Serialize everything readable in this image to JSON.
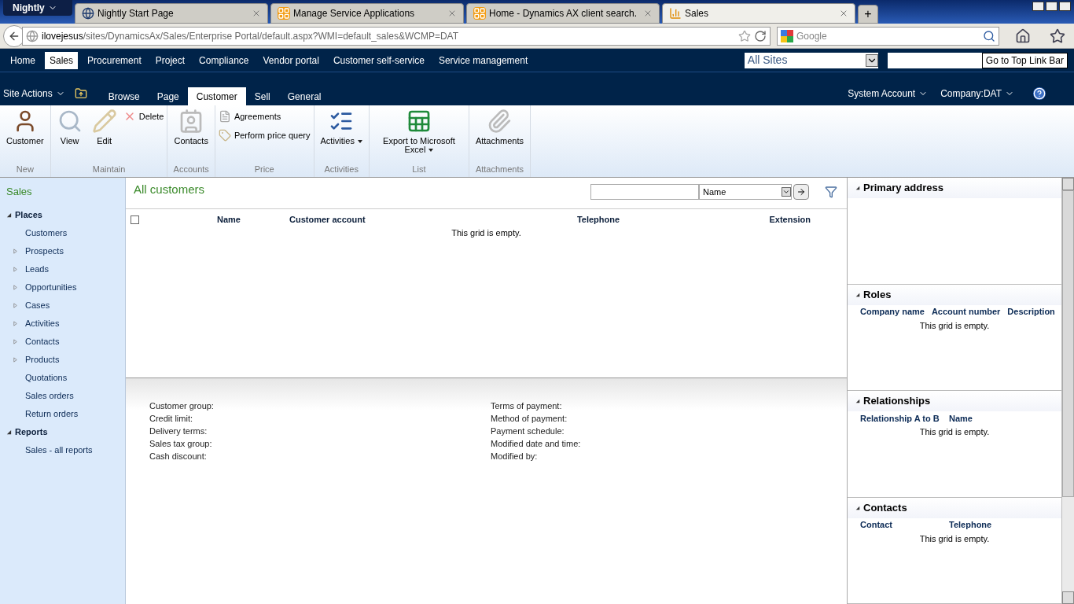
{
  "browser": {
    "menu_button": "Nightly",
    "tabs": [
      {
        "title": "Nightly Start Page",
        "selected": false
      },
      {
        "title": "Manage Service Applications",
        "selected": false
      },
      {
        "title": "Home - Dynamics AX client search.",
        "selected": false
      },
      {
        "title": "Sales",
        "selected": true
      }
    ],
    "new_tab": "+",
    "address": {
      "host": "ilovejesus",
      "path": "/sites/DynamicsAx/Sales/Enterprise Portal/default.aspx?WMI=default_sales&WCMP=DAT"
    },
    "search": {
      "placeholder": "Google"
    }
  },
  "top_links": [
    {
      "label": "Home",
      "selected": false
    },
    {
      "label": "Sales",
      "selected": true
    },
    {
      "label": "Procurement",
      "selected": false
    },
    {
      "label": "Project",
      "selected": false
    },
    {
      "label": "Compliance",
      "selected": false
    },
    {
      "label": "Vendor portal",
      "selected": false
    },
    {
      "label": "Customer self-service",
      "selected": false
    },
    {
      "label": "Service management",
      "selected": false
    }
  ],
  "site_search": {
    "scope": "All Sites",
    "tooltip": "Go to Top Link Bar"
  },
  "site_actions": "Site Actions",
  "ribbon_tabs": [
    {
      "label": "Browse",
      "selected": false
    },
    {
      "label": "Page",
      "selected": false
    },
    {
      "label": "Customer",
      "selected": true
    },
    {
      "label": "Sell",
      "selected": false
    },
    {
      "label": "General",
      "selected": false
    }
  ],
  "user": {
    "account": "System Account",
    "company": "Company:DAT"
  },
  "ribbon_groups": [
    {
      "label": "New",
      "buttons": [
        {
          "kind": "large",
          "label": "Customer"
        }
      ]
    },
    {
      "label": "Maintain",
      "buttons": [
        {
          "kind": "large",
          "label": "View"
        },
        {
          "kind": "large",
          "label": "Edit"
        },
        {
          "kind": "small",
          "label": "Delete"
        }
      ]
    },
    {
      "label": "Accounts",
      "buttons": [
        {
          "kind": "large",
          "label": "Contacts"
        }
      ]
    },
    {
      "label": "Price",
      "buttons": [
        {
          "kind": "small",
          "label": "Agreements"
        },
        {
          "kind": "small",
          "label": "Perform price query"
        }
      ]
    },
    {
      "label": "Activities",
      "buttons": [
        {
          "kind": "large",
          "label": "Activities",
          "dropdown": true
        }
      ]
    },
    {
      "label": "List",
      "buttons": [
        {
          "kind": "large",
          "label": "Export to Microsoft Excel",
          "dropdown": true
        }
      ]
    },
    {
      "label": "Attachments",
      "buttons": [
        {
          "kind": "large",
          "label": "Attachments"
        }
      ]
    }
  ],
  "sidebar": {
    "title": "Sales",
    "sections": [
      {
        "label": "Places",
        "expanded": true,
        "items": [
          {
            "label": "Customers",
            "expandable": false
          },
          {
            "label": "Prospects",
            "expandable": true
          },
          {
            "label": "Leads",
            "expandable": true
          },
          {
            "label": "Opportunities",
            "expandable": true
          },
          {
            "label": "Cases",
            "expandable": true
          },
          {
            "label": "Activities",
            "expandable": true
          },
          {
            "label": "Contacts",
            "expandable": true
          },
          {
            "label": "Products",
            "expandable": true
          },
          {
            "label": "Quotations",
            "expandable": false
          },
          {
            "label": "Sales orders",
            "expandable": false
          },
          {
            "label": "Return orders",
            "expandable": false
          }
        ]
      },
      {
        "label": "Reports",
        "expanded": true,
        "items": [
          {
            "label": "Sales - all reports",
            "expandable": false
          }
        ]
      }
    ]
  },
  "list": {
    "title": "All customers",
    "filter_field": "Name",
    "columns": [
      "Name",
      "Customer account",
      "Telephone",
      "Extension"
    ],
    "empty": "This grid is empty.",
    "checked": false
  },
  "details": {
    "left": [
      "Customer group:",
      "Credit limit:",
      "Delivery terms:",
      "Sales tax group:",
      "Cash discount:"
    ],
    "right": [
      "Terms of payment:",
      "Method of payment:",
      "Payment schedule:",
      "Modified date and time:",
      "Modified by:"
    ]
  },
  "factboxes": [
    {
      "title": "Primary address",
      "expanded": true
    },
    {
      "title": "Roles",
      "columns": [
        "Company name",
        "Account number",
        "Description"
      ],
      "empty": "This grid is empty.",
      "expanded": true
    },
    {
      "title": "Relationships",
      "columns": [
        "Relationship A to B",
        "Name"
      ],
      "empty": "This grid is empty.",
      "expanded": true
    },
    {
      "title": "Contacts",
      "columns": [
        "Contact",
        "Telephone"
      ],
      "empty": "This grid is empty.",
      "expanded": true
    }
  ]
}
